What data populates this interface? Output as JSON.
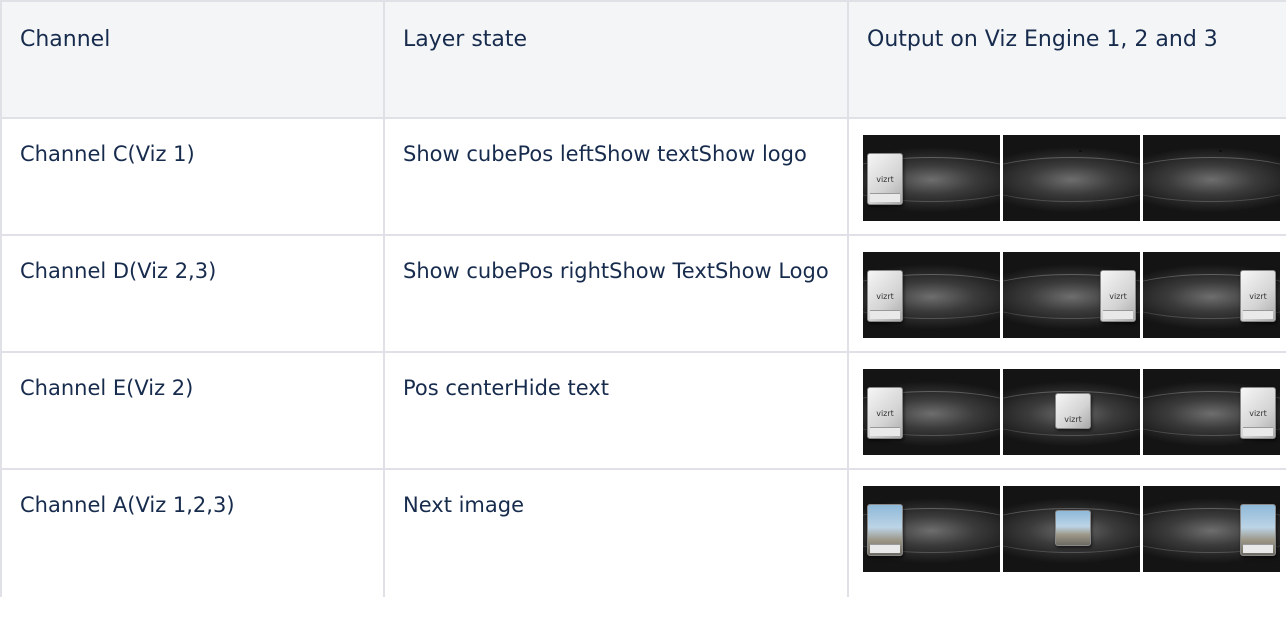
{
  "headers": [
    "Channel",
    "Layer state",
    "Output on Viz Engine 1, 2 and 3"
  ],
  "rows": [
    {
      "channel": "Channel C(Viz 1)",
      "state": "Show cubePos leftShow textShow logo",
      "outputs": [
        "cube-left",
        "empty",
        "empty"
      ]
    },
    {
      "channel": "Channel D(Viz 2,3)",
      "state": "Show cubePos rightShow TextShow Logo",
      "outputs": [
        "cube-left",
        "cube-right",
        "cube-right"
      ]
    },
    {
      "channel": "Channel E(Viz 2)",
      "state": "Pos centerHide text",
      "outputs": [
        "cube-left",
        "cube-center",
        "cube-right"
      ]
    },
    {
      "channel": "Channel A(Viz 1,2,3)",
      "state": "Next image",
      "outputs": [
        "image-left",
        "image-center",
        "image-right"
      ]
    }
  ],
  "logo_text": "vizrt"
}
